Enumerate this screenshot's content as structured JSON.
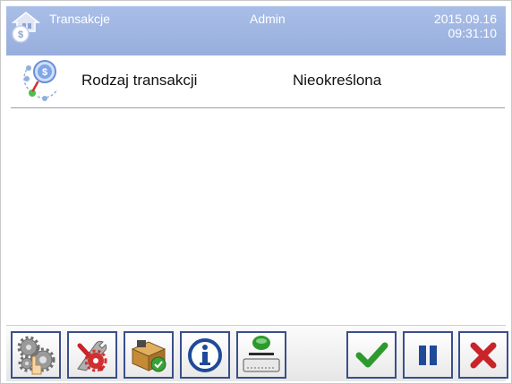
{
  "header": {
    "title": "Transakcje",
    "user": "Admin",
    "date": "2015.09.16",
    "time": "09:31:10",
    "icon": "money-home-icon"
  },
  "rows": [
    {
      "label": "Rodzaj transakcji",
      "value": "Nieokreślona",
      "icon": "transaction-type-icon"
    }
  ],
  "toolbar": {
    "left": [
      {
        "name": "settings-gears-button",
        "icon": "gears-touch-icon"
      },
      {
        "name": "tools-settings-button",
        "icon": "tools-gear-icon"
      },
      {
        "name": "products-database-button",
        "icon": "box-check-icon"
      },
      {
        "name": "info-button",
        "icon": "info-icon"
      },
      {
        "name": "weighing-pan-button",
        "icon": "scale-pan-icon"
      }
    ],
    "right": [
      {
        "name": "confirm-button",
        "icon": "checkmark-icon"
      },
      {
        "name": "pause-button",
        "icon": "pause-icon"
      },
      {
        "name": "cancel-button",
        "icon": "close-x-icon"
      }
    ]
  },
  "colors": {
    "header_bg": "#a9bee7",
    "button_border": "#3a4f8a",
    "confirm_green": "#2e9a2e",
    "cancel_red": "#c8242a",
    "pause_blue": "#1f4a9a"
  }
}
